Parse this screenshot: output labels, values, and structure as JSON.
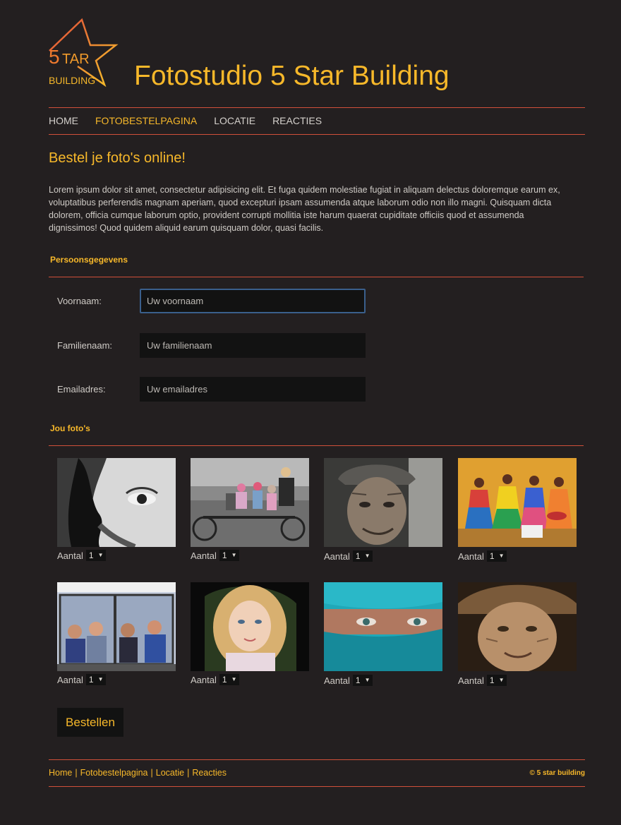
{
  "header": {
    "logo_text_top": "5",
    "logo_text_star": "TAR",
    "logo_text_bottom": "BUILDING",
    "title": "Fotostudio 5 Star Building"
  },
  "nav": {
    "items": [
      {
        "label": "HOME",
        "active": false
      },
      {
        "label": "FOTOBESTELPAGINA",
        "active": true
      },
      {
        "label": "LOCATIE",
        "active": false
      },
      {
        "label": "REACTIES",
        "active": false
      }
    ]
  },
  "main": {
    "heading": "Bestel je foto's online!",
    "intro": "Lorem ipsum dolor sit amet, consectetur adipisicing elit. Et fuga quidem molestiae fugiat in aliquam delectus doloremque earum ex, voluptatibus perferendis magnam aperiam, quod excepturi ipsam assumenda atque laborum odio non illo magni. Quisquam dicta dolorem, officia cumque laborum optio, provident corrupti mollitia iste harum quaerat cupiditate officiis quod et assumenda dignissimos! Quod quidem aliquid earum quisquam dolor, quasi facilis."
  },
  "personal": {
    "section_title": "Persoonsgegevens",
    "fields": [
      {
        "label": "Voornaam:",
        "placeholder": "Uw voornaam",
        "value": ""
      },
      {
        "label": "Familienaam:",
        "placeholder": "Uw familienaam",
        "value": ""
      },
      {
        "label": "Emailadres:",
        "placeholder": "Uw emailadres",
        "value": ""
      }
    ]
  },
  "photos": {
    "section_title": "Jou foto's",
    "quantity_label": "Aantal",
    "items": [
      {
        "subject": "woman-eye-bw",
        "quantity": "1"
      },
      {
        "subject": "family-tandem-bike",
        "quantity": "1"
      },
      {
        "subject": "old-man-cap",
        "quantity": "1"
      },
      {
        "subject": "colorful-women",
        "quantity": "1"
      },
      {
        "subject": "people-on-bus",
        "quantity": "1"
      },
      {
        "subject": "curly-girl",
        "quantity": "1"
      },
      {
        "subject": "turquoise-veil",
        "quantity": "1"
      },
      {
        "subject": "old-woman-hat",
        "quantity": "1"
      }
    ]
  },
  "order_button": "Bestellen",
  "footer": {
    "links": [
      "Home",
      "Fotobestelpagina",
      "Locatie",
      "Reacties"
    ],
    "separator": "|",
    "copyright": "© 5 star building"
  },
  "colors": {
    "background": "#231f20",
    "accent": "#f7b82a",
    "rule": "#d0503a",
    "input": "#121212"
  }
}
